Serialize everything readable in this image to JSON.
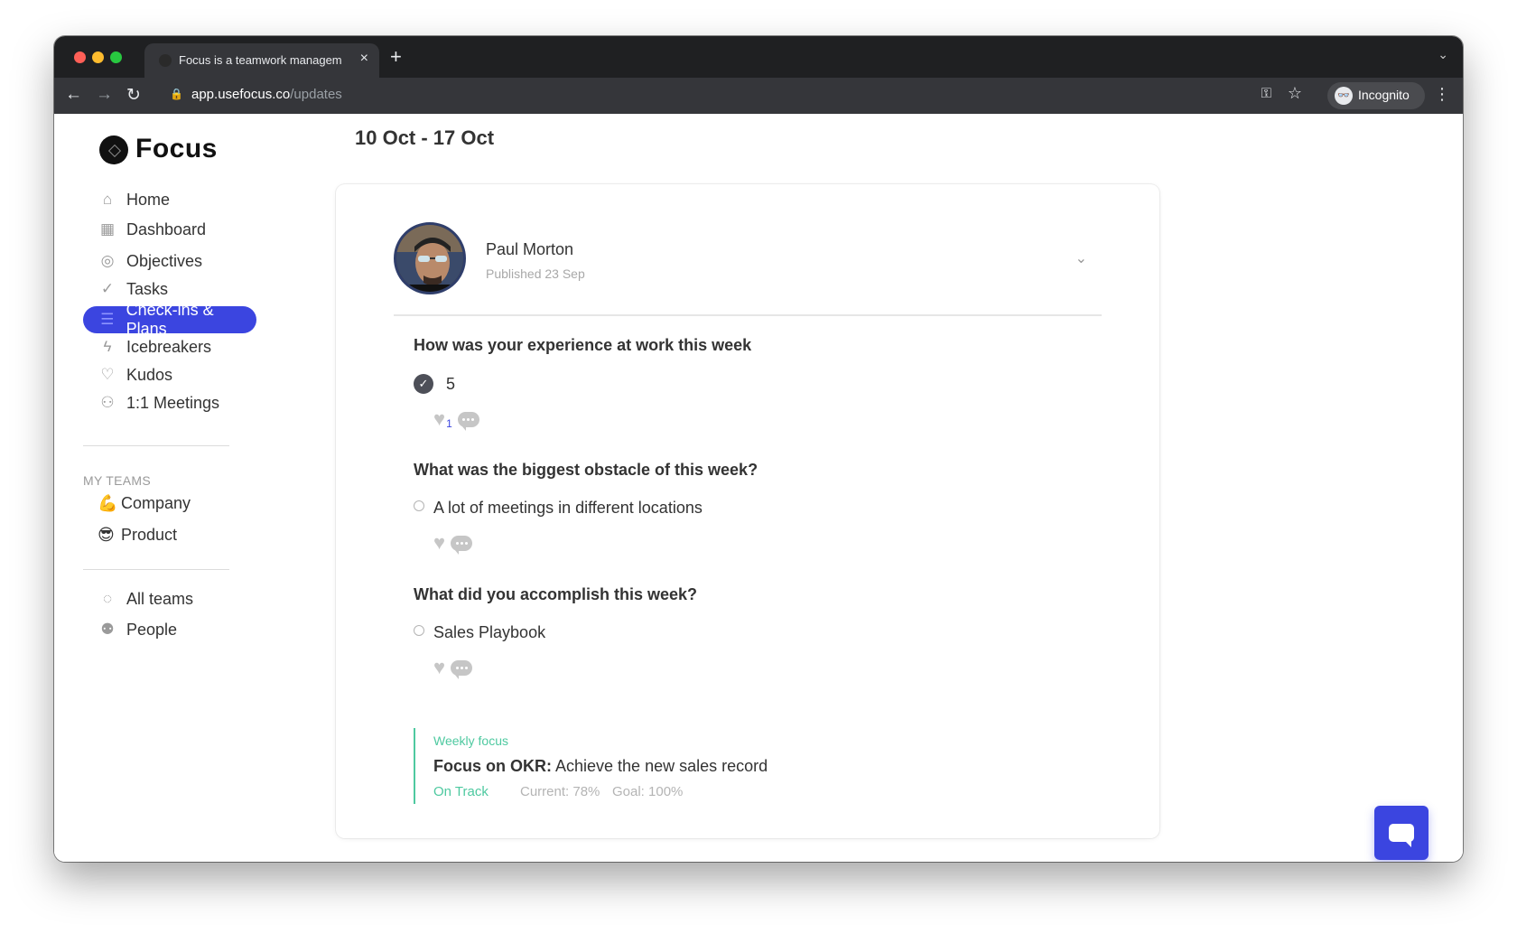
{
  "browser": {
    "tab_title": "Focus is a teamwork managem",
    "tab_close": "×",
    "new_tab": "+",
    "tab_menu": "⌄",
    "url_host": "app.usefocus.co",
    "url_path": "/updates",
    "incognito_label": "Incognito",
    "icons": {
      "back": "←",
      "forward": "→",
      "reload": "↻",
      "lock": "🔒",
      "key": "⚿",
      "star": "☆",
      "kebab": "⋮",
      "incognito": "👓"
    }
  },
  "app": {
    "logo_text": "Focus",
    "nav": [
      {
        "label": "Home",
        "icon": "home-icon",
        "glyph": "⌂"
      },
      {
        "label": "Dashboard",
        "icon": "dashboard-icon",
        "glyph": "▦"
      },
      {
        "label": "Objectives",
        "icon": "target-icon",
        "glyph": "◎"
      },
      {
        "label": "Tasks",
        "icon": "check-circle-icon",
        "glyph": "✓"
      },
      {
        "label": "Check-ins & Plans",
        "icon": "checkin-icon",
        "glyph": "☰"
      },
      {
        "label": "Icebreakers",
        "icon": "lightning-icon",
        "glyph": "ϟ"
      },
      {
        "label": "Kudos",
        "icon": "heart-badge-icon",
        "glyph": "♡"
      },
      {
        "label": "1:1 Meetings",
        "icon": "people-icon",
        "glyph": "⚇"
      }
    ],
    "my_teams_label": "MY TEAMS",
    "teams": [
      {
        "emoji": "💪",
        "label": "Company"
      },
      {
        "emoji": "😎",
        "label": "Product"
      }
    ],
    "bottom_nav": [
      {
        "label": "All teams",
        "icon": "teams-circle-icon",
        "glyph": "◌"
      },
      {
        "label": "People",
        "icon": "person-icon",
        "glyph": "⚉"
      }
    ]
  },
  "main": {
    "week_title": "10 Oct - 17 Oct",
    "card": {
      "author": "Paul Morton",
      "published": "Published 23 Sep",
      "chevron": "⌄",
      "questions": [
        {
          "question": "How was your experience at work this week",
          "answer": "5",
          "answer_checked": true,
          "likes": "1"
        },
        {
          "question": "What was the biggest obstacle of this week?",
          "answer": "A lot of meetings in different locations",
          "answer_checked": false,
          "likes": ""
        },
        {
          "question": "What did you accomplish this week?",
          "answer": "Sales Playbook",
          "answer_checked": false,
          "likes": ""
        }
      ],
      "weekly_focus": {
        "label": "Weekly focus",
        "prefix": "Focus on OKR:",
        "text": " Achieve the new sales record",
        "status": "On Track",
        "current": "Current: 78%",
        "goal": "Goal: 100%"
      }
    }
  },
  "colors": {
    "accent": "#3b45e0",
    "focus_green": "#4ec9a0"
  }
}
